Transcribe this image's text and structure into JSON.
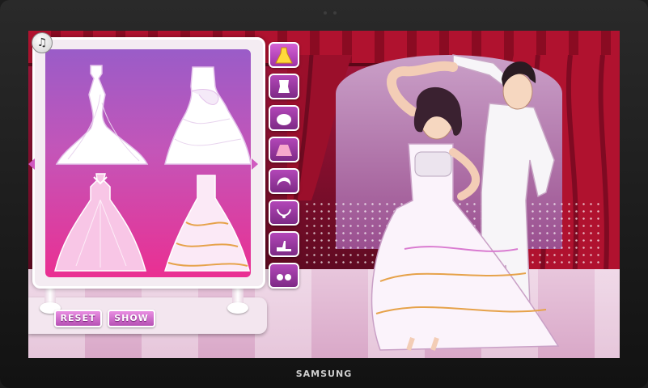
{
  "device": {
    "brand": "SAMSUNG"
  },
  "game": {
    "music_button_icon": "music-note-icon",
    "buttons": {
      "reset_label": "RESET",
      "show_label": "SHOW"
    },
    "dresses": [
      {
        "name": "mermaid-gown",
        "position": "top-left"
      },
      {
        "name": "ruffle-ballgown",
        "position": "top-right"
      },
      {
        "name": "draped-halter-gown",
        "position": "bottom-left"
      },
      {
        "name": "tiered-ballgown",
        "position": "bottom-right"
      }
    ],
    "categories": [
      {
        "icon": "dress-icon",
        "active": true
      },
      {
        "icon": "top-icon"
      },
      {
        "icon": "hat-icon"
      },
      {
        "icon": "skirt-icon"
      },
      {
        "icon": "hairstyle-icon"
      },
      {
        "icon": "necklace-icon"
      },
      {
        "icon": "shoes-icon"
      },
      {
        "icon": "earrings-icon"
      }
    ],
    "colors": {
      "accent": "#c455b8",
      "button": "#b650b4",
      "curtain": "#a8163c"
    }
  }
}
